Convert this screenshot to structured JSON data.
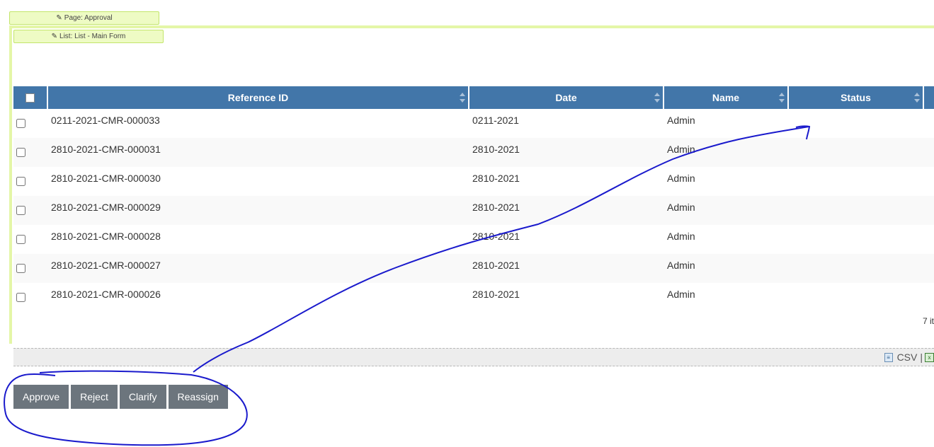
{
  "tags": {
    "page": "Page: Approval",
    "list": "List: List - Main Form"
  },
  "table": {
    "columns": [
      "Reference ID",
      "Date",
      "Name",
      "Status"
    ],
    "rows": [
      {
        "ref": "0211-2021-CMR-000033",
        "date": "0211-2021",
        "name": "Admin",
        "status": ""
      },
      {
        "ref": "2810-2021-CMR-000031",
        "date": "2810-2021",
        "name": "Admin",
        "status": ""
      },
      {
        "ref": "2810-2021-CMR-000030",
        "date": "2810-2021",
        "name": "Admin",
        "status": ""
      },
      {
        "ref": "2810-2021-CMR-000029",
        "date": "2810-2021",
        "name": "Admin",
        "status": ""
      },
      {
        "ref": "2810-2021-CMR-000028",
        "date": "2810-2021",
        "name": "Admin",
        "status": ""
      },
      {
        "ref": "2810-2021-CMR-000027",
        "date": "2810-2021",
        "name": "Admin",
        "status": ""
      },
      {
        "ref": "2810-2021-CMR-000026",
        "date": "2810-2021",
        "name": "Admin",
        "status": ""
      }
    ],
    "items_count": "7 it"
  },
  "export": {
    "csv": "CSV",
    "separator": "|"
  },
  "actions": {
    "approve": "Approve",
    "reject": "Reject",
    "clarify": "Clarify",
    "reassign": "Reassign"
  },
  "colors": {
    "header": "#4276a9",
    "button": "#6c757d",
    "annotation": "#1a1acc",
    "tag": "#eefbc4"
  }
}
